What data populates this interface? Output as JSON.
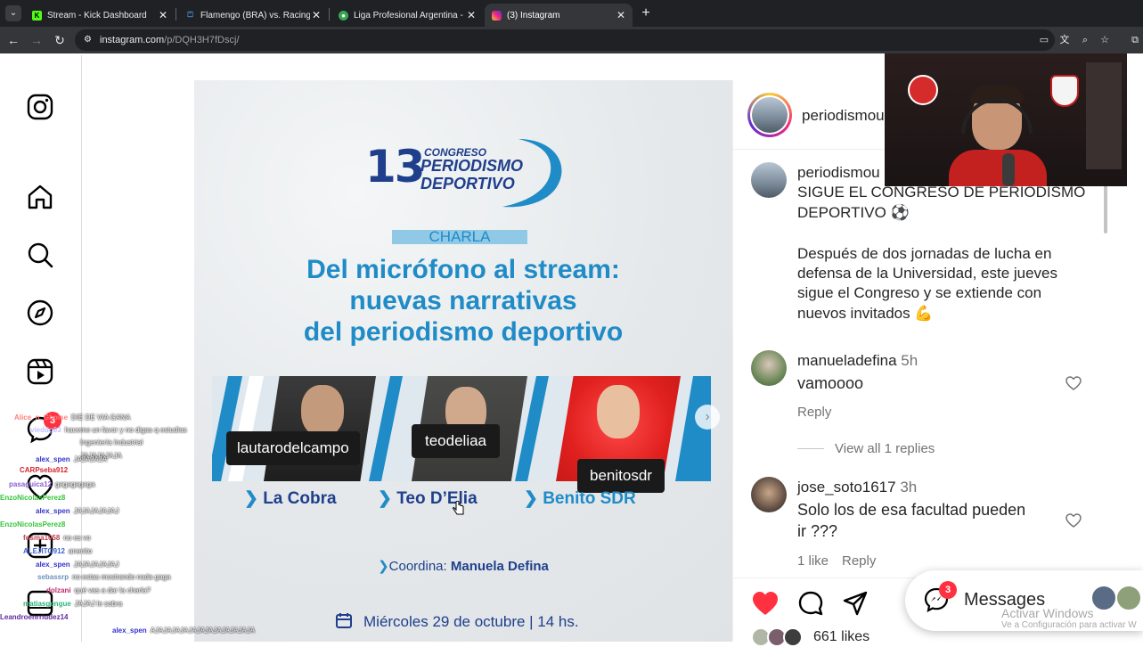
{
  "browser": {
    "tabs": [
      {
        "label": "Stream - Kick Dashboard",
        "icon": "kick-icon",
        "color": "#53fc18"
      },
      {
        "label": "Flamengo (BRA) vs. Racing Club",
        "icon": "tv-icon",
        "color": "#1a73e8"
      },
      {
        "label": "Liga Profesional Argentina - PC",
        "icon": "soccer-ball-icon",
        "color": "#34a853"
      },
      {
        "label": "(3) Instagram",
        "icon": "instagram-icon",
        "color": "#e1306c"
      }
    ],
    "url_host": "instagram.com",
    "url_path": "/p/DQH3H7fDscj/"
  },
  "sidebar": {
    "icons": [
      "instagram-logo-icon",
      "home-icon",
      "search-icon",
      "explore-icon",
      "reels-icon",
      "messenger-icon",
      "heart-icon",
      "create-icon",
      "profile-icon"
    ],
    "badge_count": "3"
  },
  "post_image": {
    "edition_number": "13",
    "congress_line1": "Congreso",
    "congress_line2": "PERIODISMO",
    "congress_line3": "DEPORTIVO",
    "category": "CHARLA",
    "headline_line1": "Del micrófono al stream:",
    "headline_line2": "nuevas narrativas",
    "headline_line3": "del periodismo deportivo",
    "speakers": [
      {
        "handle": "lautarodelcampo",
        "name": "La Cobra"
      },
      {
        "handle": "teodeliaa",
        "name": "Teo D’Elia"
      },
      {
        "handle": "benitosdr",
        "name": "Benito SDR"
      }
    ],
    "coord_label": "Coordina:",
    "coord_name": "Manuela Defina",
    "date_text": "Miércoles 29 de octubre | 14 hs."
  },
  "post_panel": {
    "author": "periodismou",
    "caption_author": "periodismou",
    "caption_line1": "SIGUE EL CONGRESO DE PERIODISMO",
    "caption_line2": "DEPORTIVO ⚽",
    "caption_para_l1": "Después de dos jornadas de lucha en",
    "caption_para_l2": "defensa de la Universidad, este jueves",
    "caption_para_l3": "sigue el Congreso y se extiende con",
    "caption_para_l4": "nuevos invitados 💪",
    "comments": [
      {
        "user": "manueladefina",
        "time": "5h",
        "text": "vamoooo",
        "reply": "Reply",
        "view_replies": "View all 1 replies"
      },
      {
        "user": "jose_soto1617",
        "time": "3h",
        "text_l1": "Solo los de esa facultad pueden",
        "text_l2": "ir ???",
        "likes": "1 like",
        "reply": "Reply"
      }
    ],
    "likes_count": "661 likes"
  },
  "messages": {
    "label": "Messages",
    "badge": "3"
  },
  "windows_watermark": {
    "line1": "Activar Windows",
    "line2": "Ve a Configuración para activar W"
  },
  "chat": [
    {
      "user": "Alice_n_Ghoise",
      "color": "#ff7f7f",
      "msg": "DIE DE VIA GANA"
    },
    {
      "user": "vieddg03",
      "color": "#c0c0ff",
      "msg": "haceme un favor y no digas q estudias"
    },
    {
      "user": "",
      "color": "#ffffff",
      "msg": "Ingeniería Industrial"
    },
    {
      "user": "",
      "color": "#ffffff",
      "msg": "JAJAJAJAJA"
    },
    {
      "user": "alex_spen",
      "color": "#3333cc",
      "msg": "JAJAJAJA"
    },
    {
      "user": "CARPseba912",
      "color": "#d4262e",
      "msg": ""
    },
    {
      "user": "pasaguica12",
      "color": "#8a5fd1",
      "msg": "gagagagaga"
    },
    {
      "user": "EnzoNicolasPerez8",
      "color": "#37c43c",
      "msg": ""
    },
    {
      "user": "alex_spen",
      "color": "#3333cc",
      "msg": "JAJAJAJAJAJ"
    },
    {
      "user": "EnzoNicolasPerez8",
      "color": "#37c43c",
      "msg": ""
    },
    {
      "user": "fosma1058",
      "color": "#c0404f",
      "msg": "no es vo"
    },
    {
      "user": "ALEJITO912",
      "color": "#3f62d6",
      "msg": "anenito"
    },
    {
      "user": "alex_spen",
      "color": "#3333cc",
      "msg": "JAJAJAJAJAJ"
    },
    {
      "user": "sebassrp",
      "color": "#6c8fbf",
      "msg": "no estas mostrando nada gaga"
    },
    {
      "user": "dolzani",
      "color": "#c02a6a",
      "msg": "qué vas a dar la charla?"
    },
    {
      "user": "matiasgengue",
      "color": "#2db47a",
      "msg": "JAJAJ le sobra"
    },
    {
      "user": "Leandroenrriudez14",
      "color": "#5f2a9c",
      "msg": ""
    },
    {
      "user": "alex_spen",
      "color": "#3333cc",
      "msg": "AJAJAJAJAJAJAJAJAJAJAJAJA"
    }
  ],
  "colors": {
    "ig_blue_text": "#1f8bc7",
    "ig_dark_blue": "#1f3f8c",
    "like_red": "#ff3040"
  }
}
